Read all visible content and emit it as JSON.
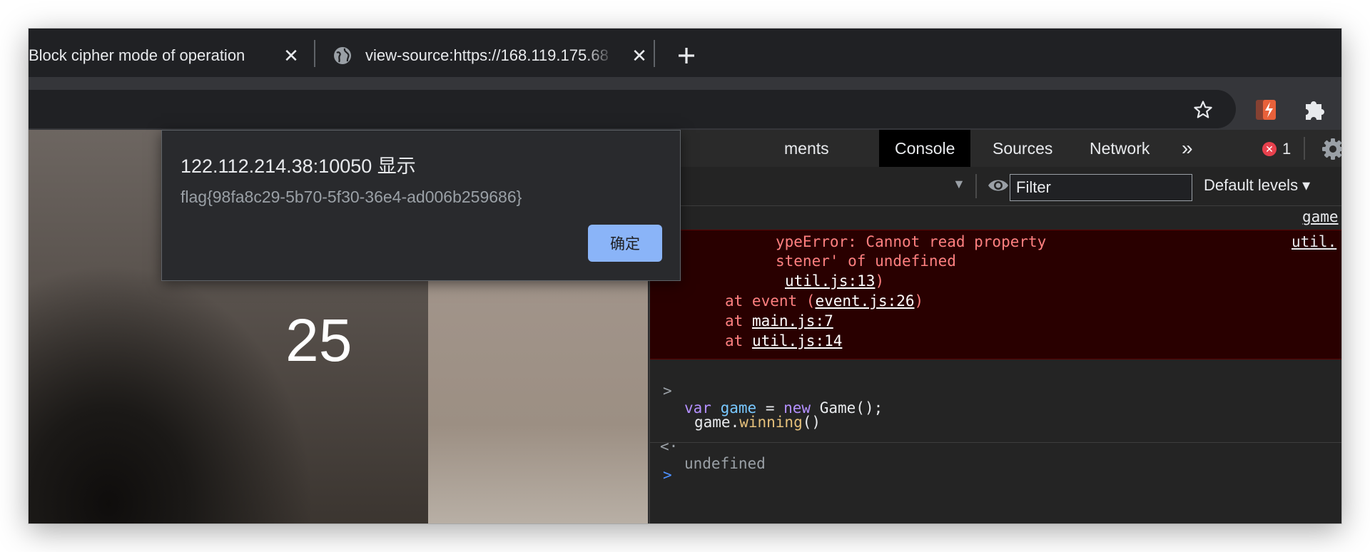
{
  "tabs": [
    {
      "title": "Block cipher mode of operation"
    },
    {
      "title": "view-source:https://168.119.175.68"
    }
  ],
  "page": {
    "counter": "25"
  },
  "devtools": {
    "tabs": [
      {
        "label": "ments"
      },
      {
        "label": "Console"
      },
      {
        "label": "Sources"
      },
      {
        "label": "Network"
      }
    ],
    "more_tabs": "»",
    "error_count": "1",
    "filter_placeholder": "Filter",
    "levels_label": "Default levels ▾",
    "context_arrow": "▼"
  },
  "console": {
    "source_link_1": "game",
    "error": {
      "source": "util.",
      "line1": "ypeError: Cannot read property",
      "line2": "stener' of undefined",
      "frame1_link": "util.js:13",
      "frame1_close": ")",
      "frame2_prefix": "at event (",
      "frame2_link": "event.js:26",
      "frame2_close": ")",
      "frame3_prefix": "at ",
      "frame3_link": "main.js:7",
      "frame4_prefix": "at ",
      "frame4_link": "util.js:14"
    },
    "input1": {
      "kw_var": "var",
      "ident": "game",
      "op_eq": "=",
      "kw_new": "new",
      "rest": "Game();"
    },
    "input2": {
      "obj": "game.",
      "method": "winning",
      "parens": "()"
    },
    "result": "undefined",
    "prompt": ">",
    "result_prompt": "<·"
  },
  "dialog": {
    "title": "122.112.214.38:10050 显示",
    "message": "flag{98fa8c29-5b70-5f30-36e4-ad006b259686}",
    "ok_label": "确定"
  }
}
